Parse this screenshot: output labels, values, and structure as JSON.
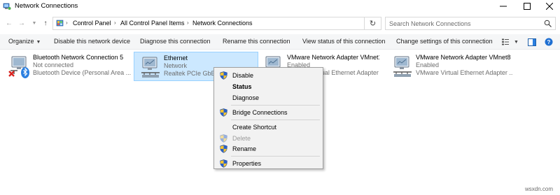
{
  "window": {
    "title": "Network Connections",
    "controls": {
      "minimize": "minimize-icon",
      "maximize": "maximize-icon",
      "close": "close-icon"
    }
  },
  "address_bar": {
    "breadcrumbs": [
      "Control Panel",
      "All Control Panel Items",
      "Network Connections"
    ],
    "search_placeholder": "Search Network Connections"
  },
  "commands": {
    "organize": "Organize",
    "disable": "Disable this network device",
    "diagnose": "Diagnose this connection",
    "rename": "Rename this connection",
    "view_status": "View status of this connection",
    "change_settings": "Change settings of this connection"
  },
  "connections": [
    {
      "name": "Bluetooth Network Connection 5",
      "status": "Not connected",
      "device": "Bluetooth Device (Personal Area ...",
      "icon": "bluetooth-adapter-icon"
    },
    {
      "name": "Ethernet",
      "status": "Network",
      "device": "Realtek PCIe GbE Fa...",
      "icon": "ethernet-adapter-icon"
    },
    {
      "name": "VMware Network Adapter VMnet1",
      "status": "Enabled",
      "device": "VMware Virtual Ethernet Adapter ...",
      "icon": "vmware-adapter-icon"
    },
    {
      "name": "VMware Network Adapter VMnet8",
      "status": "Enabled",
      "device": "VMware Virtual Ethernet Adapter ...",
      "icon": "vmware-adapter-icon"
    }
  ],
  "context_menu": {
    "items": [
      {
        "label": "Disable",
        "icon": "shield-icon"
      },
      {
        "label": "Status"
      },
      {
        "label": "Diagnose"
      },
      {
        "label": "Bridge Connections",
        "icon": "shield-icon"
      },
      {
        "label": "Create Shortcut"
      },
      {
        "label": "Delete",
        "icon": "shield-icon",
        "disabled": true
      },
      {
        "label": "Rename",
        "icon": "shield-icon"
      },
      {
        "label": "Properties",
        "icon": "shield-icon"
      }
    ]
  },
  "colors": {
    "selection_bg": "#cce8ff",
    "selection_border": "#99d1ff",
    "menu_bg": "#f2f2f2",
    "shield_blue": "#2b62c9",
    "shield_yellow": "#f4c430",
    "error_red": "#d9231f",
    "bluetooth_blue": "#2b7fe0"
  },
  "watermark": "wsxdn.com"
}
